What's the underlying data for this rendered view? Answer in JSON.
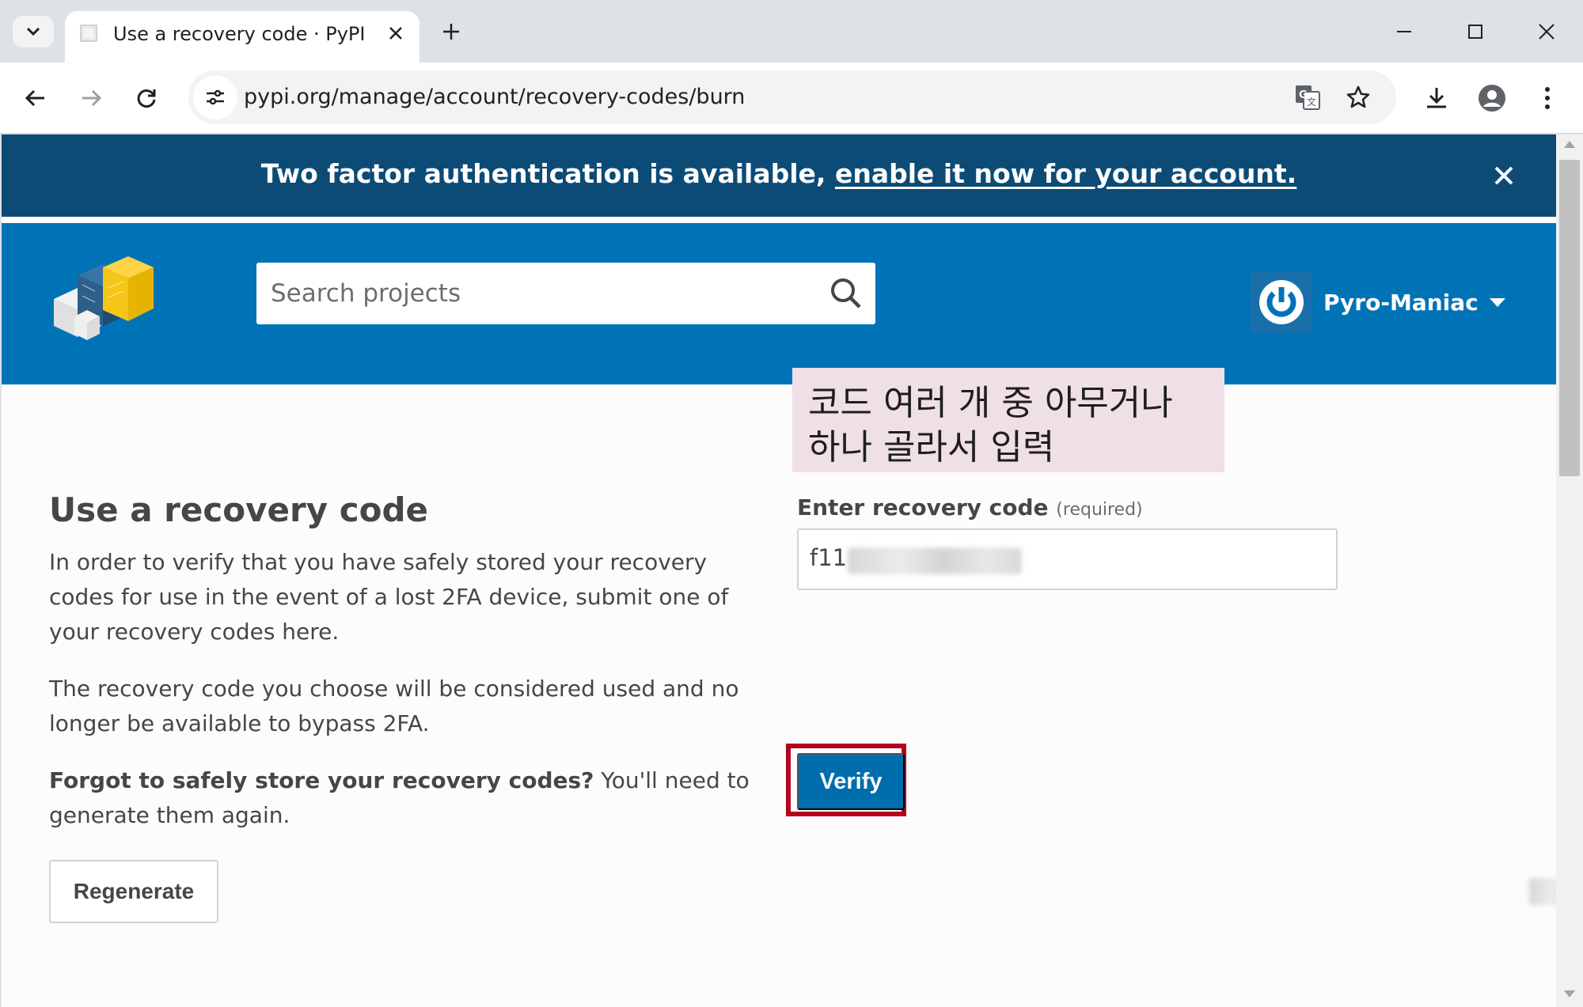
{
  "browser": {
    "tab_title": "Use a recovery code · PyPI",
    "url": "pypi.org/manage/account/recovery-codes/burn",
    "icons": [
      "tab-search-icon",
      "favicon-icon",
      "close-icon",
      "plus-icon",
      "minimize-icon",
      "maximize-icon",
      "close-window-icon",
      "back-icon",
      "forward-icon",
      "reload-icon",
      "site-info-icon",
      "translate-icon",
      "star-icon",
      "download-icon",
      "profile-icon",
      "kebab-menu-icon"
    ]
  },
  "notice": {
    "text": "Two factor authentication is available, ",
    "link_text": "enable it now for your account."
  },
  "header": {
    "search_placeholder": "Search projects",
    "username": "Pyro-Maniac"
  },
  "annotation": {
    "line1": "코드 여러 개 중 아무거나",
    "line2": "하나 골라서 입력"
  },
  "main": {
    "title": "Use a recovery code",
    "paragraph1": "In order to verify that you have safely stored your recovery codes for use in the event of a lost 2FA device, submit one of your recovery codes here.",
    "paragraph2": "The recovery code you choose will be considered used and no longer be available to bypass 2FA.",
    "paragraph3_bold": "Forgot to safely store your recovery codes?",
    "paragraph3_rest": " You'll need to generate them again.",
    "regenerate_label": "Regenerate"
  },
  "form": {
    "label": "Enter recovery code",
    "required_text": "(required)",
    "code_value_visible": "f11",
    "verify_label": "Verify"
  },
  "colors": {
    "notice_bg": "#0c4b76",
    "header_bg": "#0073b7",
    "button_bg": "#006dad",
    "highlight": "#b5001e",
    "annotation_bg": "#efdfe7"
  }
}
